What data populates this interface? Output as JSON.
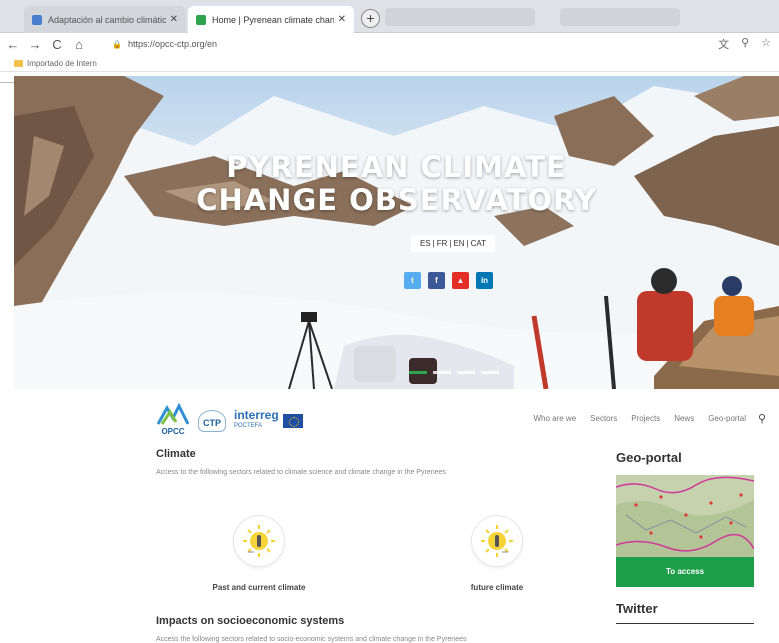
{
  "browser": {
    "tabs": [
      {
        "title": "Adaptación al cambio climático",
        "favicon_color": "#4a7fd0"
      },
      {
        "title": "Home | Pyrenean climate change",
        "favicon_color": "#2ea44f"
      }
    ],
    "new_tab_symbol": "+",
    "nav": {
      "back": "←",
      "forward": "→",
      "reload": "C",
      "home": "⌂"
    },
    "url": "https://opcc-ctp.org/en",
    "bookmarks": [
      {
        "label": "Importado de Intern"
      }
    ]
  },
  "hero": {
    "title_line1": "PYRENEAN CLIMATE",
    "title_line2": "CHANGE OBSERVATORY",
    "languages": [
      "ES",
      "FR",
      "EN",
      "CAT"
    ],
    "lang_separator": "|",
    "social": [
      {
        "name": "twitter",
        "glyph": "t",
        "color": "#55acee"
      },
      {
        "name": "facebook",
        "glyph": "f",
        "color": "#3b5998"
      },
      {
        "name": "youtube",
        "glyph": "▲",
        "color": "#e52d27"
      },
      {
        "name": "linkedin",
        "glyph": "in",
        "color": "#0077b5"
      }
    ],
    "slides_active": 0
  },
  "header": {
    "logo_opcc": "OPCC",
    "logo_ctp": "CTP",
    "logo_interreg": "interreg",
    "logo_interreg_sub": "POCTEFA",
    "nav": [
      "Who are we",
      "Sectors",
      "Projects",
      "News",
      "Geo-portal"
    ]
  },
  "main": {
    "climate": {
      "title": "Climate",
      "desc": "Access to the following sectors related to climate science and climate change in the Pyrenees",
      "cards": [
        {
          "label": "Past and current climate"
        },
        {
          "label": "future climate"
        }
      ]
    },
    "impacts": {
      "title": "Impacts on socioeconomic systems",
      "desc": "Access the following sectors related to socio-economic systems and climate change in the Pyrenees"
    }
  },
  "sidebar": {
    "geoportal_title": "Geo-portal",
    "access_label": "To access",
    "twitter_title": "Twitter"
  },
  "colors": {
    "accent_green": "#1e9e48",
    "sun_yellow": "#f5d43a"
  }
}
